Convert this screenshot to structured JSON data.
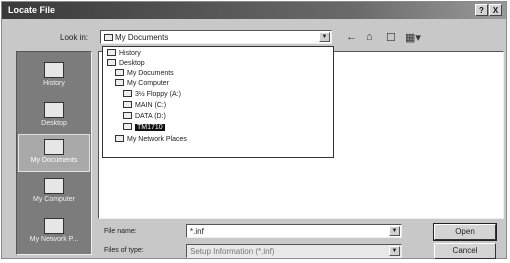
{
  "window": {
    "title": "Locate File"
  },
  "title_buttons": [
    "?",
    "X"
  ],
  "toolbar": {
    "look_in_label": "Look in:",
    "look_in_value": "My Documents",
    "back_glyph": "←",
    "up_glyph": "⌂",
    "new_folder_glyph": "☐",
    "views_glyph": "▦▾"
  },
  "places": [
    {
      "label": "History",
      "icon": "history-icon"
    },
    {
      "label": "Desktop",
      "icon": "desktop-icon"
    },
    {
      "label": "My Documents",
      "icon": "my-documents-icon",
      "active": true
    },
    {
      "label": "My Computer",
      "icon": "my-computer-icon"
    },
    {
      "label": "My Network P...",
      "icon": "network-places-icon"
    }
  ],
  "dropdown": [
    {
      "label": "History"
    },
    {
      "label": "Desktop"
    },
    {
      "label": "My Documents"
    },
    {
      "label": "My Computer"
    },
    {
      "label": "3½ Floppy (A:)"
    },
    {
      "label": "MAIN (C:)"
    },
    {
      "label": "DATA (D:)"
    },
    {
      "label": "TM1710",
      "selected": true
    },
    {
      "label": "My Network Places"
    }
  ],
  "form": {
    "file_name_label": "File name:",
    "file_name_value": "*.inf",
    "file_type_label": "Files of type:",
    "file_type_value": "Setup Information (*.inf)",
    "open_label": "Open",
    "cancel_label": "Cancel"
  }
}
